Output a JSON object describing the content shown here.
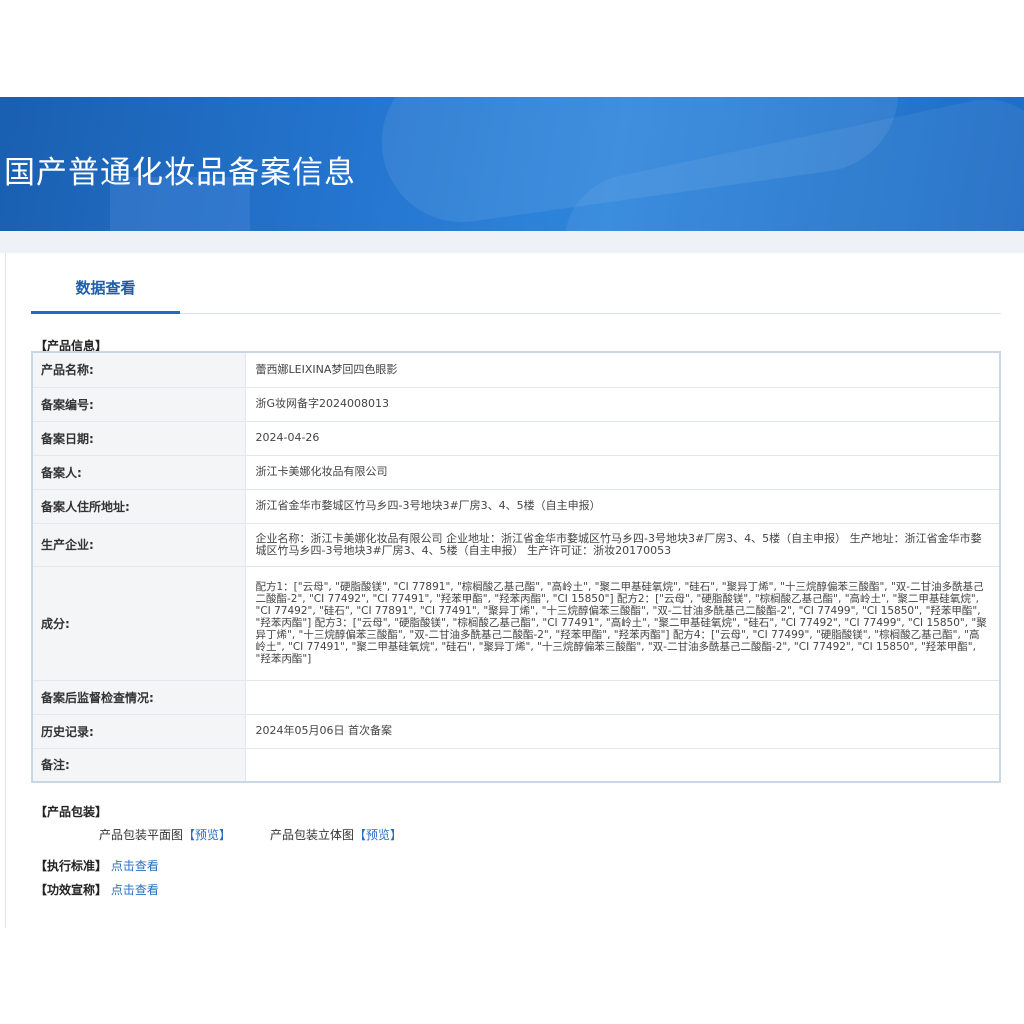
{
  "header": {
    "title": "国产普通化妆品备案信息"
  },
  "tabs": [
    {
      "label": "数据查看"
    }
  ],
  "product_info": {
    "section_title": "【产品信息】",
    "rows": [
      {
        "label": "产品名称:",
        "value": "蕾西娜LEIXINA梦回四色眼影"
      },
      {
        "label": "备案编号:",
        "value": "浙G妆网备字2024008013"
      },
      {
        "label": "备案日期:",
        "value": "2024-04-26"
      },
      {
        "label": "备案人:",
        "value": "浙江卡美娜化妆品有限公司"
      },
      {
        "label": "备案人住所地址:",
        "value": "浙江省金华市婺城区竹马乡四-3号地块3#厂房3、4、5楼（自主申报）"
      },
      {
        "label": "生产企业:",
        "value": "企业名称：浙江卡美娜化妆品有限公司 企业地址：浙江省金华市婺城区竹马乡四-3号地块3#厂房3、4、5楼（自主申报） 生产地址：浙江省金华市婺城区竹马乡四-3号地块3#厂房3、4、5楼（自主申报） 生产许可证：浙妆20170053"
      },
      {
        "label": "成分:",
        "value": "配方1：[\"云母\", \"硬脂酸镁\", \"CI 77891\", \"棕榈酸乙基己酯\", \"高岭土\", \"聚二甲基硅氧烷\", \"硅石\", \"聚异丁烯\", \"十三烷醇偏苯三酸酯\", \"双-二甘油多酰基己二酸酯-2\", \"CI 77492\", \"CI 77491\", \"羟苯甲酯\", \"羟苯丙酯\", \"CI 15850\"] 配方2：[\"云母\", \"硬脂酸镁\", \"棕榈酸乙基己酯\", \"高岭土\", \"聚二甲基硅氧烷\", \"CI 77492\", \"硅石\", \"CI 77891\", \"CI 77491\", \"聚异丁烯\", \"十三烷醇偏苯三酸酯\", \"双-二甘油多酰基己二酸酯-2\", \"CI 77499\", \"CI 15850\", \"羟苯甲酯\", \"羟苯丙酯\"] 配方3：[\"云母\", \"硬脂酸镁\", \"棕榈酸乙基己酯\", \"CI 77491\", \"高岭土\", \"聚二甲基硅氧烷\", \"硅石\", \"CI 77492\", \"CI 77499\", \"CI 15850\", \"聚异丁烯\", \"十三烷醇偏苯三酸酯\", \"双-二甘油多酰基己二酸酯-2\", \"羟苯甲酯\", \"羟苯丙酯\"] 配方4：[\"云母\", \"CI 77499\", \"硬脂酸镁\", \"棕榈酸乙基己酯\", \"高岭土\", \"CI 77491\", \"聚二甲基硅氧烷\", \"硅石\", \"聚异丁烯\", \"十三烷醇偏苯三酸酯\", \"双-二甘油多酰基己二酸酯-2\", \"CI 77492\", \"CI 15850\", \"羟苯甲酯\", \"羟苯丙酯\"]"
      },
      {
        "label": "备案后监督检查情况:",
        "value": ""
      },
      {
        "label": "历史记录:",
        "value": "2024年05月06日 首次备案"
      },
      {
        "label": "备注:",
        "value": ""
      }
    ]
  },
  "packaging": {
    "section_title": "【产品包装】",
    "flat_label": "产品包装平面图",
    "flat_link": "【预览】",
    "solid_label": "产品包装立体图",
    "solid_link": "【预览】"
  },
  "standard": {
    "label": "【执行标准】",
    "link": "点击查看"
  },
  "efficacy": {
    "label": "【功效宣称】",
    "link": "点击查看"
  }
}
